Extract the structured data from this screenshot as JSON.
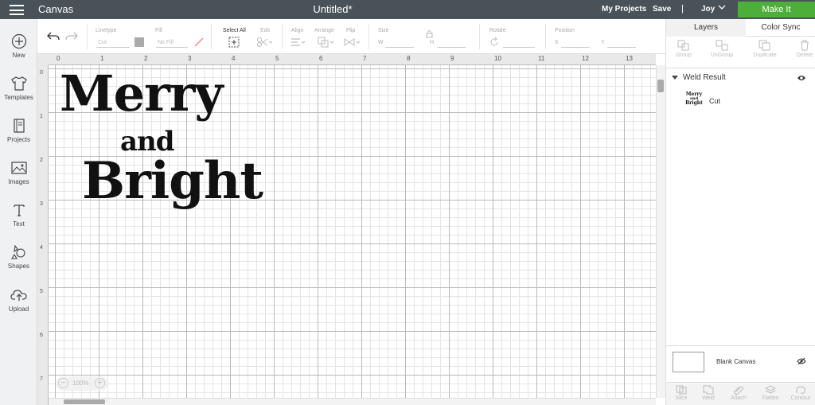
{
  "header": {
    "app_title": "Canvas",
    "doc_title": "Untitled*",
    "my_projects": "My Projects",
    "save": "Save",
    "separator": "|",
    "user": "Joy",
    "make_it": "Make It"
  },
  "sidebar": {
    "items": [
      {
        "label": "New",
        "icon": "plus-circle-icon"
      },
      {
        "label": "Templates",
        "icon": "shirt-icon"
      },
      {
        "label": "Projects",
        "icon": "book-icon"
      },
      {
        "label": "Images",
        "icon": "image-icon"
      },
      {
        "label": "Text",
        "icon": "text-icon"
      },
      {
        "label": "Shapes",
        "icon": "shapes-icon"
      },
      {
        "label": "Upload",
        "icon": "upload-cloud-icon"
      }
    ]
  },
  "toolbar": {
    "linetype_label": "Linetype",
    "linetype_value": "Cut",
    "fill_label": "Fill",
    "fill_value": "No Fill",
    "select_all": "Select All",
    "edit": "Edit",
    "align": "Align",
    "arrange": "Arrange",
    "flip": "Flip",
    "size": "Size",
    "width_label": "W",
    "height_label": "H",
    "rotate": "Rotate",
    "position": "Position",
    "x_label": "X",
    "y_label": "Y"
  },
  "rulers": {
    "horizontal": [
      "0",
      "1",
      "2",
      "3",
      "4",
      "5",
      "6",
      "7",
      "8",
      "9",
      "10",
      "11",
      "12",
      "13"
    ],
    "vertical": [
      "0",
      "1",
      "2",
      "3",
      "4",
      "5",
      "6",
      "7"
    ]
  },
  "canvas": {
    "design_lines": [
      "Merry",
      "and",
      "Bright"
    ],
    "zoom_minus": "−",
    "zoom_level": "100%",
    "zoom_plus": "+"
  },
  "panel": {
    "tabs": [
      "Layers",
      "Color Sync"
    ],
    "tools": [
      "Group",
      "UnGroup",
      "Duplicate",
      "Delete"
    ],
    "layer_group_name": "Weld Result",
    "layer_thumb_lines": [
      "Merry",
      "and",
      "Bright"
    ],
    "layer_operation": "Cut",
    "blank_canvas": "Blank Canvas",
    "bottom_tools": [
      "Slice",
      "Weld",
      "Attach",
      "Flatten",
      "Contour"
    ]
  },
  "colors": {
    "header_bg": "#485258",
    "make_it_green": "#4eae3a",
    "sidebar_bg": "#f0f1f2"
  }
}
